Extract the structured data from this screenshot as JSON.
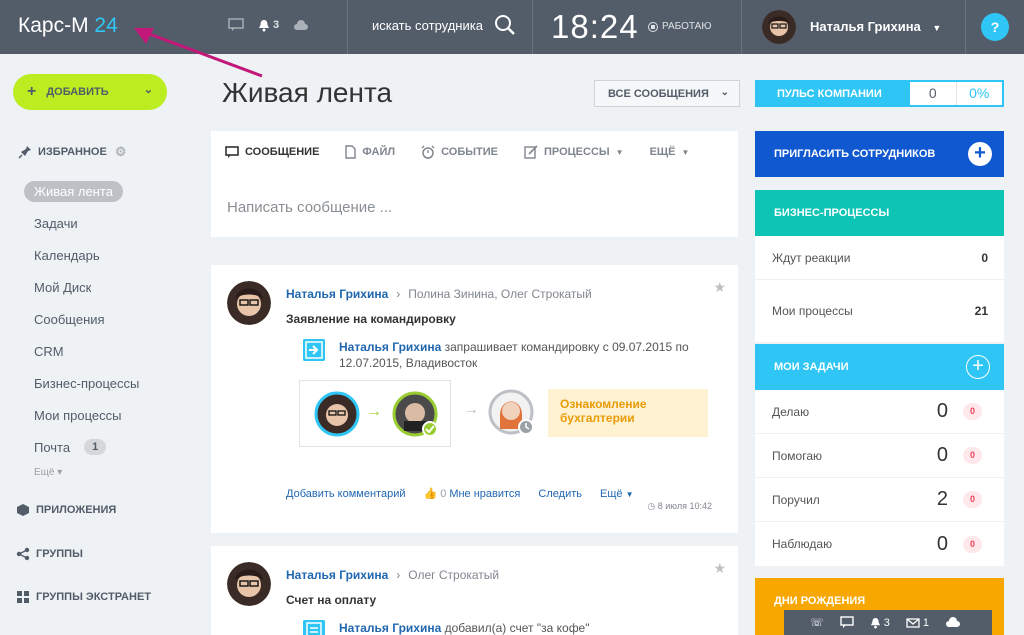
{
  "topbar": {
    "logo_text": "Карс-М",
    "logo_num": "24",
    "notif_count": "3",
    "search_placeholder": "искать сотрудника",
    "time": "18:24",
    "work_status": "РАБОТАЮ",
    "user_name": "Наталья Грихина",
    "help": "?"
  },
  "sidebar": {
    "add_label": "ДОБАВИТЬ",
    "favorites_label": "ИЗБРАННОЕ",
    "items": [
      {
        "label": "Живая лента"
      },
      {
        "label": "Задачи"
      },
      {
        "label": "Календарь"
      },
      {
        "label": "Мой Диск"
      },
      {
        "label": "Сообщения"
      },
      {
        "label": "CRM"
      },
      {
        "label": "Бизнес-процессы"
      },
      {
        "label": "Мои процессы"
      },
      {
        "label": "Почта",
        "badge": "1"
      }
    ],
    "more_label": "Ещё",
    "sections": [
      "ПРИЛОЖЕНИЯ",
      "ГРУППЫ",
      "ГРУППЫ ЭКСТРАНЕТ"
    ]
  },
  "main": {
    "title": "Живая лента",
    "filter_label": "ВСЕ СООБЩЕНИЯ",
    "composer": {
      "tabs": [
        "СООБЩЕНИЕ",
        "ФАЙЛ",
        "СОБЫТИЕ",
        "ПРОЦЕССЫ",
        "ЕЩЁ"
      ],
      "placeholder": "Написать сообщение ..."
    },
    "post1": {
      "author": "Наталья Грихина",
      "recipients": "Полина Зинина, Олег Строкатый",
      "title": "Заявление на командировку",
      "bp_author": "Наталья Грихина",
      "bp_text": "запрашивает командировку с 09.07.2015 по 12.07.2015, Владивосток",
      "step": "Ознакомление бухгалтерии",
      "add_comment": "Добавить комментарий",
      "likes": "0",
      "like_label": "Мне нравится",
      "follow": "Следить",
      "more": "Ещё",
      "date": "8 июля 10:42"
    },
    "post2": {
      "author": "Наталья Грихина",
      "recipients": "Олег Строкатый",
      "title": "Счет на оплату",
      "bp_author": "Наталья Грихина",
      "bp_text": "добавил(а) счет \"за кофе\""
    }
  },
  "right": {
    "pulse_label": "ПУЛЬС КОМПАНИИ",
    "pulse_value": "0",
    "pulse_pct": "0%",
    "invite_label": "ПРИГЛАСИТЬ СОТРУДНИКОВ",
    "bp_label": "БИЗНЕС-ПРОЦЕССЫ",
    "bp_rows": [
      {
        "label": "Ждут реакции",
        "value": "0"
      },
      {
        "label": "Мои процессы",
        "value": "21"
      }
    ],
    "tasks_label": "МОИ ЗАДАЧИ",
    "task_rows": [
      {
        "label": "Делаю",
        "value": "0",
        "badge": "0"
      },
      {
        "label": "Помогаю",
        "value": "0",
        "badge": "0"
      },
      {
        "label": "Поручил",
        "value": "2",
        "badge": "0"
      },
      {
        "label": "Наблюдаю",
        "value": "0",
        "badge": "0"
      }
    ],
    "birthdays_label": "ДНИ РОЖДЕНИЯ"
  },
  "bottombar": {
    "notif_count": "3",
    "mail_count": "1"
  },
  "colors": {
    "topbar": "#535c69",
    "accent_blue": "#2fc6f6",
    "add_green": "#bbed21",
    "invite_blue": "#1058d0",
    "teal": "#0dc4b5",
    "orange": "#f7a700"
  }
}
